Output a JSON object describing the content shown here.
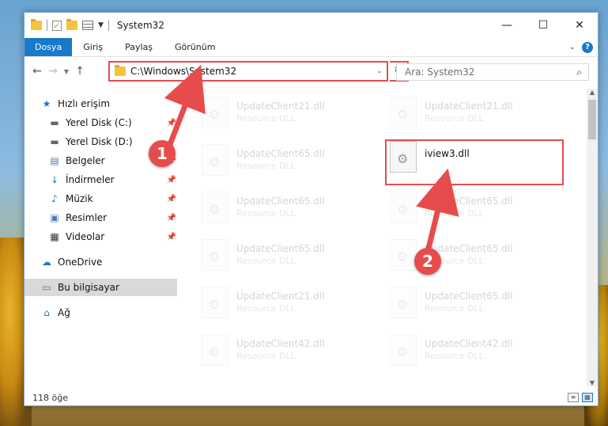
{
  "window": {
    "title": "System32",
    "controls": {
      "minimize": "—",
      "maximize": "☐",
      "close": "✕"
    }
  },
  "ribbon": {
    "tabs": [
      "Dosya",
      "Giriş",
      "Paylaş",
      "Görünüm"
    ],
    "active_tab": "Dosya",
    "help": "?"
  },
  "address": {
    "path": "C:\\Windows\\System32",
    "search_placeholder": "Ara: System32"
  },
  "sidebar": {
    "items": [
      {
        "label": "Hızlı erişim",
        "icon": "star-icon",
        "pinned": false
      },
      {
        "label": "Yerel Disk (C:)",
        "icon": "drive-icon",
        "pinned": true
      },
      {
        "label": "Yerel Disk (D:)",
        "icon": "drive-icon",
        "pinned": false
      },
      {
        "label": "Belgeler",
        "icon": "documents-icon",
        "pinned": true
      },
      {
        "label": "İndirmeler",
        "icon": "download-icon",
        "pinned": true
      },
      {
        "label": "Müzik",
        "icon": "music-icon",
        "pinned": true
      },
      {
        "label": "Resimler",
        "icon": "pictures-icon",
        "pinned": true
      },
      {
        "label": "Videolar",
        "icon": "videos-icon",
        "pinned": true
      },
      {
        "label": "OneDrive",
        "icon": "cloud-icon",
        "pinned": false
      },
      {
        "label": "Bu bilgisayar",
        "icon": "computer-icon",
        "pinned": false
      },
      {
        "label": "Ağ",
        "icon": "network-icon",
        "pinned": false
      }
    ]
  },
  "files": {
    "left_column": [
      {
        "name": "UpdateClient21.dll",
        "type": "Resource DLL"
      },
      {
        "name": "UpdateClient65.dll",
        "type": "Resource DLL"
      },
      {
        "name": "UpdateClient65.dll",
        "type": "Resource DLL"
      },
      {
        "name": "UpdateClient65.dll",
        "type": "Resource DLL"
      },
      {
        "name": "UpdateClient21.dll",
        "type": "Resource DLL"
      },
      {
        "name": "UpdateClient42.dll",
        "type": "Resource DLL"
      }
    ],
    "right_column": [
      {
        "name": "UpdateClient21.dll",
        "type": "Resource DLL"
      },
      {
        "name": "iview3.dll",
        "type": ""
      },
      {
        "name": "UpdateClient65.dll",
        "type": "Resource DLL"
      },
      {
        "name": "UpdateClient65.dll",
        "type": "Resource DLL"
      },
      {
        "name": "UpdateClient65.dll",
        "type": "Resource DLL"
      },
      {
        "name": "UpdateClient42.dll",
        "type": "Resource DLL"
      }
    ]
  },
  "status": {
    "item_count": "118 öğe"
  },
  "annotations": {
    "marker_1": "1",
    "marker_2": "2",
    "color": "#e74c4c"
  }
}
